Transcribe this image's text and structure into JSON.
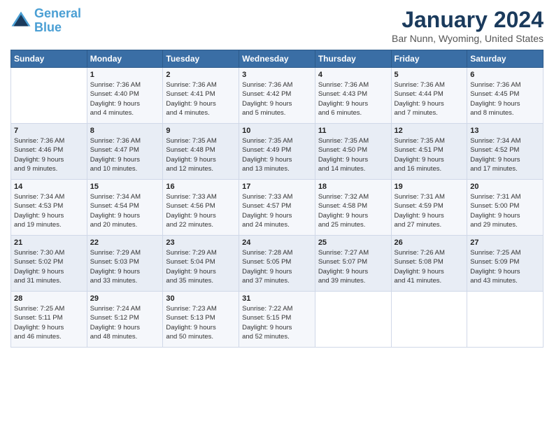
{
  "header": {
    "logo_line1": "General",
    "logo_line2": "Blue",
    "month": "January 2024",
    "location": "Bar Nunn, Wyoming, United States"
  },
  "weekdays": [
    "Sunday",
    "Monday",
    "Tuesday",
    "Wednesday",
    "Thursday",
    "Friday",
    "Saturday"
  ],
  "weeks": [
    [
      {
        "day": "",
        "info": ""
      },
      {
        "day": "1",
        "info": "Sunrise: 7:36 AM\nSunset: 4:40 PM\nDaylight: 9 hours\nand 4 minutes."
      },
      {
        "day": "2",
        "info": "Sunrise: 7:36 AM\nSunset: 4:41 PM\nDaylight: 9 hours\nand 4 minutes."
      },
      {
        "day": "3",
        "info": "Sunrise: 7:36 AM\nSunset: 4:42 PM\nDaylight: 9 hours\nand 5 minutes."
      },
      {
        "day": "4",
        "info": "Sunrise: 7:36 AM\nSunset: 4:43 PM\nDaylight: 9 hours\nand 6 minutes."
      },
      {
        "day": "5",
        "info": "Sunrise: 7:36 AM\nSunset: 4:44 PM\nDaylight: 9 hours\nand 7 minutes."
      },
      {
        "day": "6",
        "info": "Sunrise: 7:36 AM\nSunset: 4:45 PM\nDaylight: 9 hours\nand 8 minutes."
      }
    ],
    [
      {
        "day": "7",
        "info": "Sunrise: 7:36 AM\nSunset: 4:46 PM\nDaylight: 9 hours\nand 9 minutes."
      },
      {
        "day": "8",
        "info": "Sunrise: 7:36 AM\nSunset: 4:47 PM\nDaylight: 9 hours\nand 10 minutes."
      },
      {
        "day": "9",
        "info": "Sunrise: 7:35 AM\nSunset: 4:48 PM\nDaylight: 9 hours\nand 12 minutes."
      },
      {
        "day": "10",
        "info": "Sunrise: 7:35 AM\nSunset: 4:49 PM\nDaylight: 9 hours\nand 13 minutes."
      },
      {
        "day": "11",
        "info": "Sunrise: 7:35 AM\nSunset: 4:50 PM\nDaylight: 9 hours\nand 14 minutes."
      },
      {
        "day": "12",
        "info": "Sunrise: 7:35 AM\nSunset: 4:51 PM\nDaylight: 9 hours\nand 16 minutes."
      },
      {
        "day": "13",
        "info": "Sunrise: 7:34 AM\nSunset: 4:52 PM\nDaylight: 9 hours\nand 17 minutes."
      }
    ],
    [
      {
        "day": "14",
        "info": "Sunrise: 7:34 AM\nSunset: 4:53 PM\nDaylight: 9 hours\nand 19 minutes."
      },
      {
        "day": "15",
        "info": "Sunrise: 7:34 AM\nSunset: 4:54 PM\nDaylight: 9 hours\nand 20 minutes."
      },
      {
        "day": "16",
        "info": "Sunrise: 7:33 AM\nSunset: 4:56 PM\nDaylight: 9 hours\nand 22 minutes."
      },
      {
        "day": "17",
        "info": "Sunrise: 7:33 AM\nSunset: 4:57 PM\nDaylight: 9 hours\nand 24 minutes."
      },
      {
        "day": "18",
        "info": "Sunrise: 7:32 AM\nSunset: 4:58 PM\nDaylight: 9 hours\nand 25 minutes."
      },
      {
        "day": "19",
        "info": "Sunrise: 7:31 AM\nSunset: 4:59 PM\nDaylight: 9 hours\nand 27 minutes."
      },
      {
        "day": "20",
        "info": "Sunrise: 7:31 AM\nSunset: 5:00 PM\nDaylight: 9 hours\nand 29 minutes."
      }
    ],
    [
      {
        "day": "21",
        "info": "Sunrise: 7:30 AM\nSunset: 5:02 PM\nDaylight: 9 hours\nand 31 minutes."
      },
      {
        "day": "22",
        "info": "Sunrise: 7:29 AM\nSunset: 5:03 PM\nDaylight: 9 hours\nand 33 minutes."
      },
      {
        "day": "23",
        "info": "Sunrise: 7:29 AM\nSunset: 5:04 PM\nDaylight: 9 hours\nand 35 minutes."
      },
      {
        "day": "24",
        "info": "Sunrise: 7:28 AM\nSunset: 5:05 PM\nDaylight: 9 hours\nand 37 minutes."
      },
      {
        "day": "25",
        "info": "Sunrise: 7:27 AM\nSunset: 5:07 PM\nDaylight: 9 hours\nand 39 minutes."
      },
      {
        "day": "26",
        "info": "Sunrise: 7:26 AM\nSunset: 5:08 PM\nDaylight: 9 hours\nand 41 minutes."
      },
      {
        "day": "27",
        "info": "Sunrise: 7:25 AM\nSunset: 5:09 PM\nDaylight: 9 hours\nand 43 minutes."
      }
    ],
    [
      {
        "day": "28",
        "info": "Sunrise: 7:25 AM\nSunset: 5:11 PM\nDaylight: 9 hours\nand 46 minutes."
      },
      {
        "day": "29",
        "info": "Sunrise: 7:24 AM\nSunset: 5:12 PM\nDaylight: 9 hours\nand 48 minutes."
      },
      {
        "day": "30",
        "info": "Sunrise: 7:23 AM\nSunset: 5:13 PM\nDaylight: 9 hours\nand 50 minutes."
      },
      {
        "day": "31",
        "info": "Sunrise: 7:22 AM\nSunset: 5:15 PM\nDaylight: 9 hours\nand 52 minutes."
      },
      {
        "day": "",
        "info": ""
      },
      {
        "day": "",
        "info": ""
      },
      {
        "day": "",
        "info": ""
      }
    ]
  ]
}
